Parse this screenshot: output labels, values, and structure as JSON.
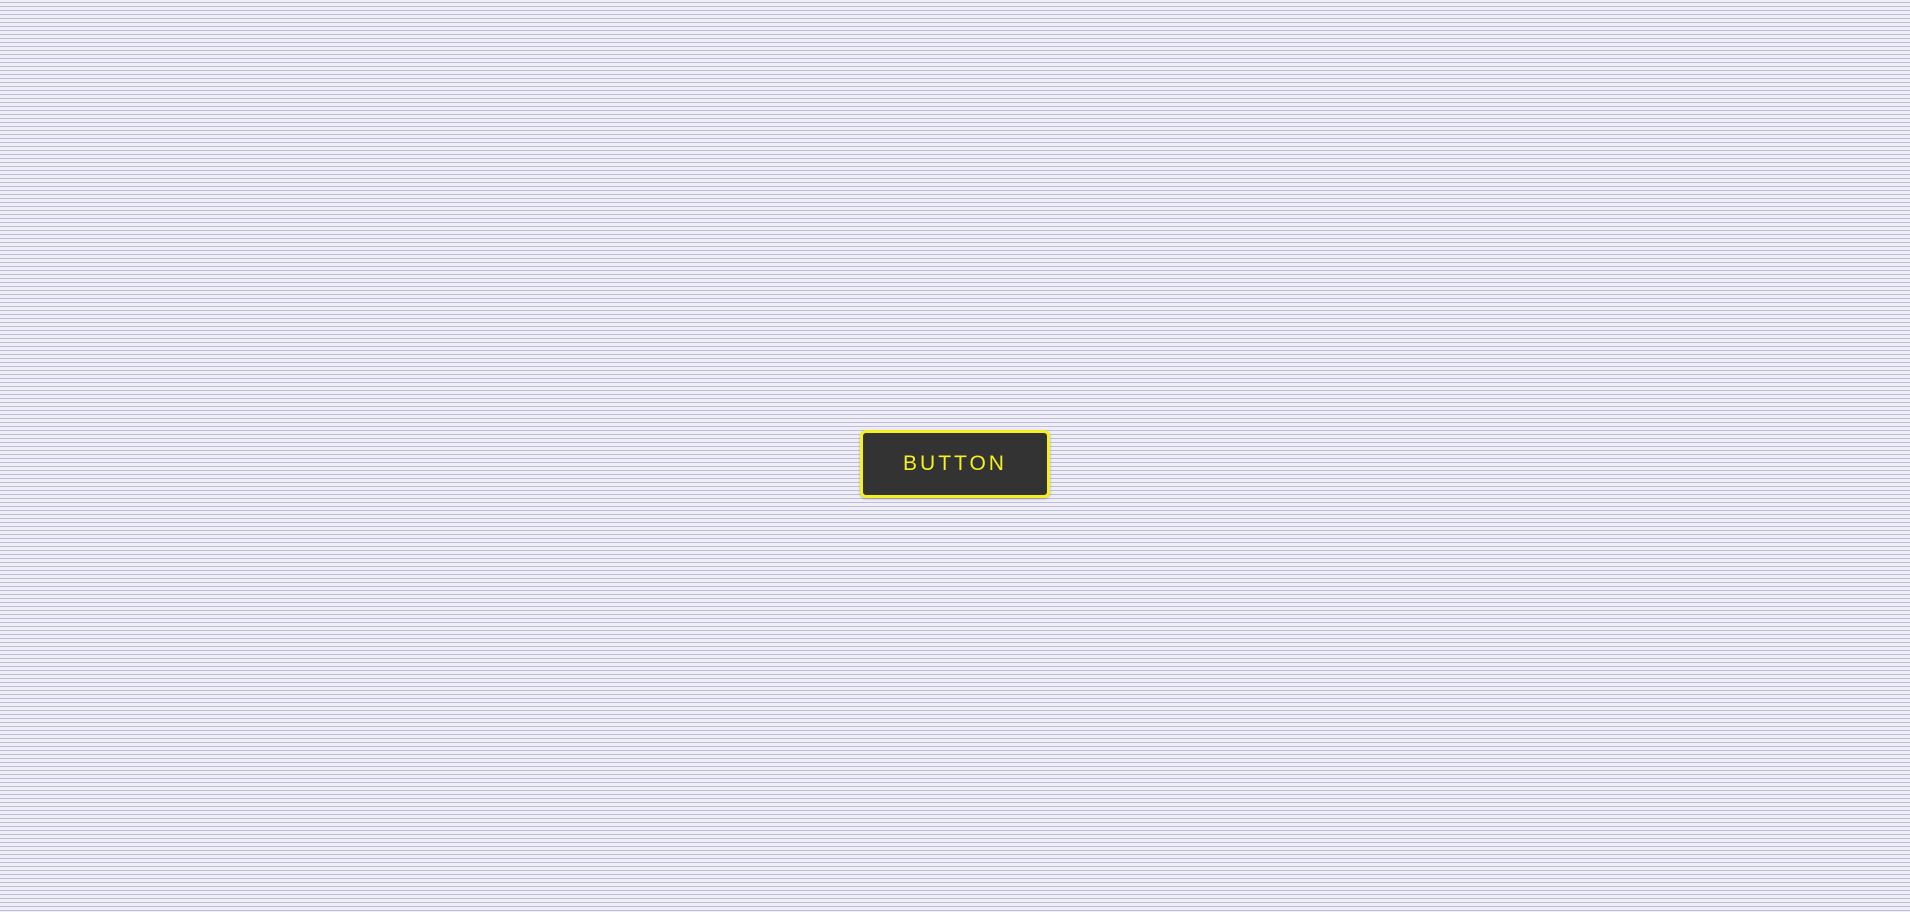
{
  "main": {
    "button_label": "BUTTON"
  },
  "colors": {
    "background": "#eeeef4",
    "pattern_line": "#9696c8",
    "button_background": "#333333",
    "button_border": "#f7f01f",
    "button_text": "#f7f01f"
  }
}
